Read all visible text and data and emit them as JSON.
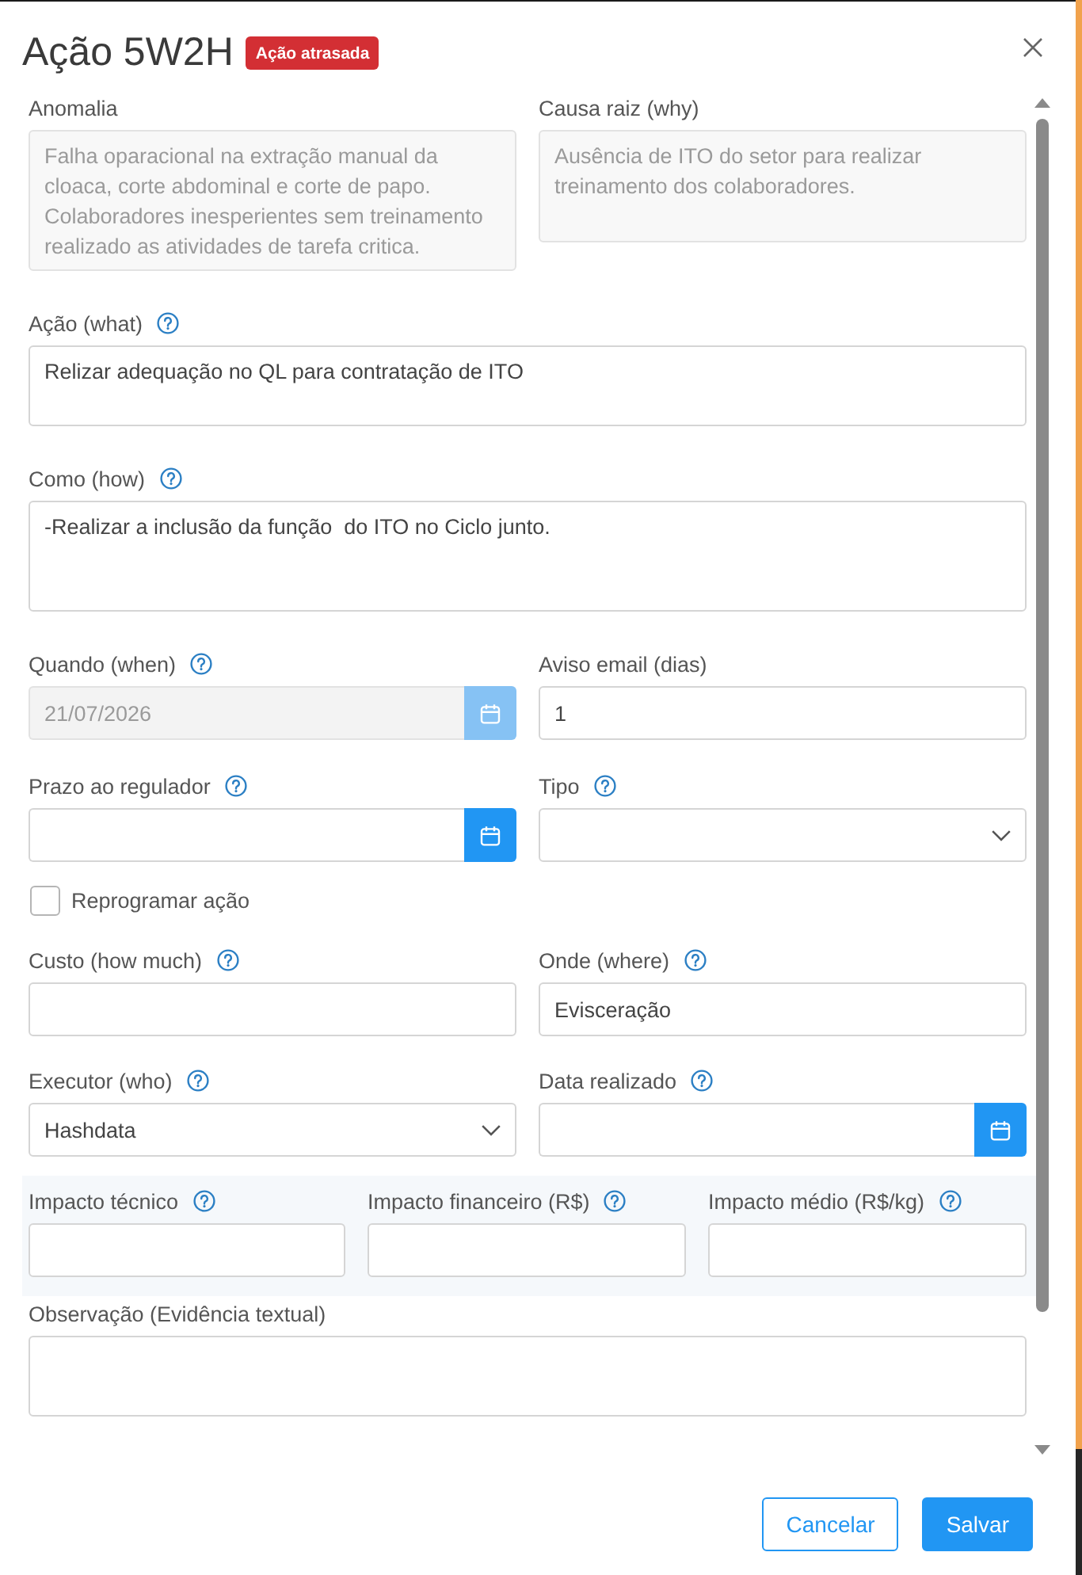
{
  "dialog": {
    "title": "Ação 5W2H",
    "badge": "Ação atrasada"
  },
  "rows": [
    {
      "shaded": false,
      "fields": [
        {
          "kind": "textarea",
          "label": "Anomalia",
          "help": false,
          "disabled": true,
          "value": "Falha oparacional na extração manual da cloaca, corte abdominal e corte de papo. Colaboradores inesperientes sem treinamento realizado as atividades de tarefa critica."
        },
        {
          "kind": "textarea",
          "label": "Causa raiz (why)",
          "help": false,
          "disabled": true,
          "value": "Ausência de ITO do setor para realizar treinamento dos colaboradores."
        }
      ]
    },
    {
      "shaded": false,
      "fields": [
        {
          "kind": "textarea",
          "label": "Ação (what)",
          "help": true,
          "disabled": false,
          "value": "Relizar adequação no QL para contratação de ITO"
        }
      ]
    },
    {
      "shaded": false,
      "fields": [
        {
          "kind": "textarea",
          "label": "Como (how)",
          "help": true,
          "disabled": false,
          "value": "-Realizar a inclusão da função  do ITO no Ciclo junto."
        }
      ]
    },
    {
      "shaded": false,
      "fields": [
        {
          "kind": "date",
          "label": "Quando (when)",
          "help": true,
          "disabled": true,
          "value": "21/07/2026"
        },
        {
          "kind": "input",
          "label": "Aviso email (dias)",
          "help": false,
          "disabled": false,
          "value": "1"
        }
      ]
    },
    {
      "shaded": false,
      "fields": [
        {
          "kind": "date",
          "label": "Prazo ao regulador",
          "help": true,
          "disabled": false
        },
        {
          "kind": "select",
          "label": "Tipo",
          "help": true,
          "disabled": false
        }
      ]
    },
    {
      "shaded": false,
      "fields": [
        {
          "kind": "checkbox",
          "label": "Reprogramar ação",
          "checked": false
        }
      ]
    },
    {
      "shaded": false,
      "fields": [
        {
          "kind": "input",
          "label": "Custo (how much)",
          "help": true,
          "disabled": false
        },
        {
          "kind": "input",
          "label": "Onde (where)",
          "help": true,
          "disabled": false,
          "value": "Evisceração"
        }
      ]
    },
    {
      "shaded": false,
      "fields": [
        {
          "kind": "select",
          "label": "Executor (who)",
          "help": true,
          "disabled": false,
          "value": "Hashdata"
        },
        {
          "kind": "date",
          "label": "Data realizado",
          "help": true,
          "disabled": false
        }
      ]
    },
    {
      "shaded": true,
      "fields": [
        {
          "kind": "input",
          "label": "Impacto técnico",
          "help": true,
          "disabled": false
        },
        {
          "kind": "input",
          "label": "Impacto financeiro (R$)",
          "help": true,
          "disabled": false
        },
        {
          "kind": "input",
          "label": "Impacto médio (R$/kg)",
          "help": true,
          "disabled": false
        }
      ]
    },
    {
      "shaded": false,
      "fields": [
        {
          "kind": "textarea",
          "label": "Observação (Evidência textual)",
          "help": false,
          "disabled": false
        }
      ]
    }
  ],
  "footer": {
    "buttons": [
      {
        "label": "Cancelar",
        "kind": "outline"
      },
      {
        "label": "Salvar",
        "kind": "primary"
      }
    ]
  }
}
